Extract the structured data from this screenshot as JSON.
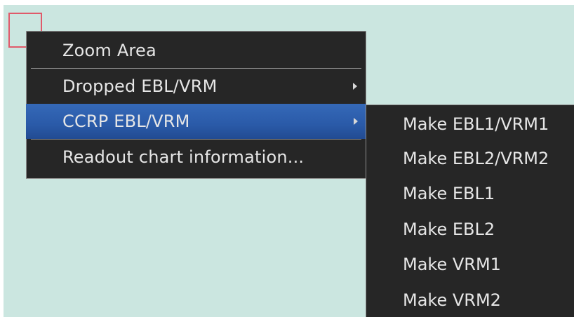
{
  "colors": {
    "chart_background": "#cbe6e0",
    "menu_background": "#262626",
    "menu_text": "#e6e6e6",
    "selected_background": "#2a5aa8",
    "cursor_box": "#e05a6a"
  },
  "context_menu": {
    "items": [
      {
        "label": "Zoom Area",
        "has_submenu": false
      },
      {
        "label": "Dropped EBL/VRM",
        "has_submenu": true
      },
      {
        "label": "CCRP EBL/VRM",
        "has_submenu": true,
        "selected": true
      },
      {
        "label": "Readout chart information...",
        "has_submenu": false
      }
    ]
  },
  "submenu": {
    "items": [
      {
        "label": "Make EBL1/VRM1"
      },
      {
        "label": "Make EBL2/VRM2"
      },
      {
        "label": "Make EBL1"
      },
      {
        "label": "Make EBL2"
      },
      {
        "label": "Make VRM1"
      },
      {
        "label": "Make VRM2"
      }
    ]
  }
}
